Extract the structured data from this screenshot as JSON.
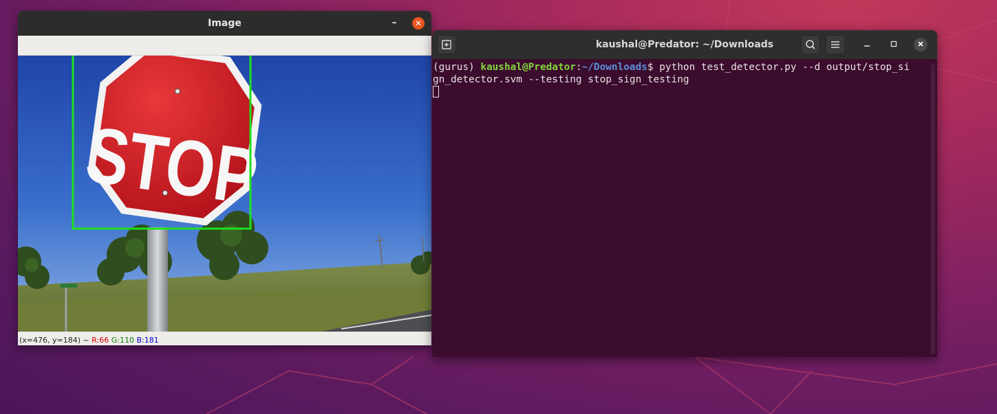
{
  "image_window": {
    "title": "Image",
    "minimize_glyph": "–",
    "close_glyph": "✕",
    "sign_text": "STOP",
    "street_sign_text": "…",
    "status": {
      "coords": "(x=476, y=184) ~",
      "r": "R:66",
      "g": "G:110",
      "b": "B:181"
    },
    "detection_box_color": "#1fe01f"
  },
  "terminal_window": {
    "title": "kaushal@Predator: ~/Downloads",
    "icons": {
      "new_tab": "new-tab-icon",
      "search": "search-icon",
      "menu": "hamburger-menu-icon"
    },
    "prompt_env": "(gurus) ",
    "prompt_user": "kaushal@Predator",
    "prompt_sep": ":",
    "prompt_path": "~/Downloads",
    "prompt_dollar": "$ ",
    "command_line1": "python test_detector.py --d output/stop_si",
    "command_line2": "gn_detector.svm --testing stop_sign_testing",
    "colors": {
      "background": "#3b0c2d",
      "user": "#7fd63b",
      "path": "#5d8fd9"
    }
  }
}
